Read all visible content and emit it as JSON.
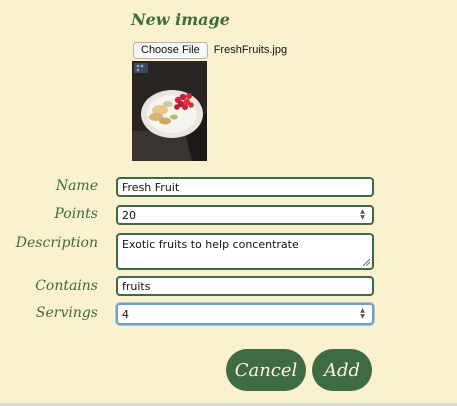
{
  "form": {
    "heading": "New image",
    "file": {
      "button_label": "Choose File",
      "file_name": "FreshFruits.jpg"
    },
    "fields": {
      "name": {
        "label": "Name",
        "value": "Fresh Fruit"
      },
      "points": {
        "label": "Points",
        "value": "20"
      },
      "description": {
        "label": "Description",
        "value": "Exotic fruits to help concentrate"
      },
      "contains": {
        "label": "Contains",
        "value": "fruits"
      },
      "servings": {
        "label": "Servings",
        "value": "4"
      }
    },
    "buttons": {
      "cancel": "Cancel",
      "add": "Add"
    }
  },
  "colors": {
    "background": "#fbf1cf",
    "accent_green": "#3f6b42",
    "focus_blue": "#6fa0c4"
  }
}
